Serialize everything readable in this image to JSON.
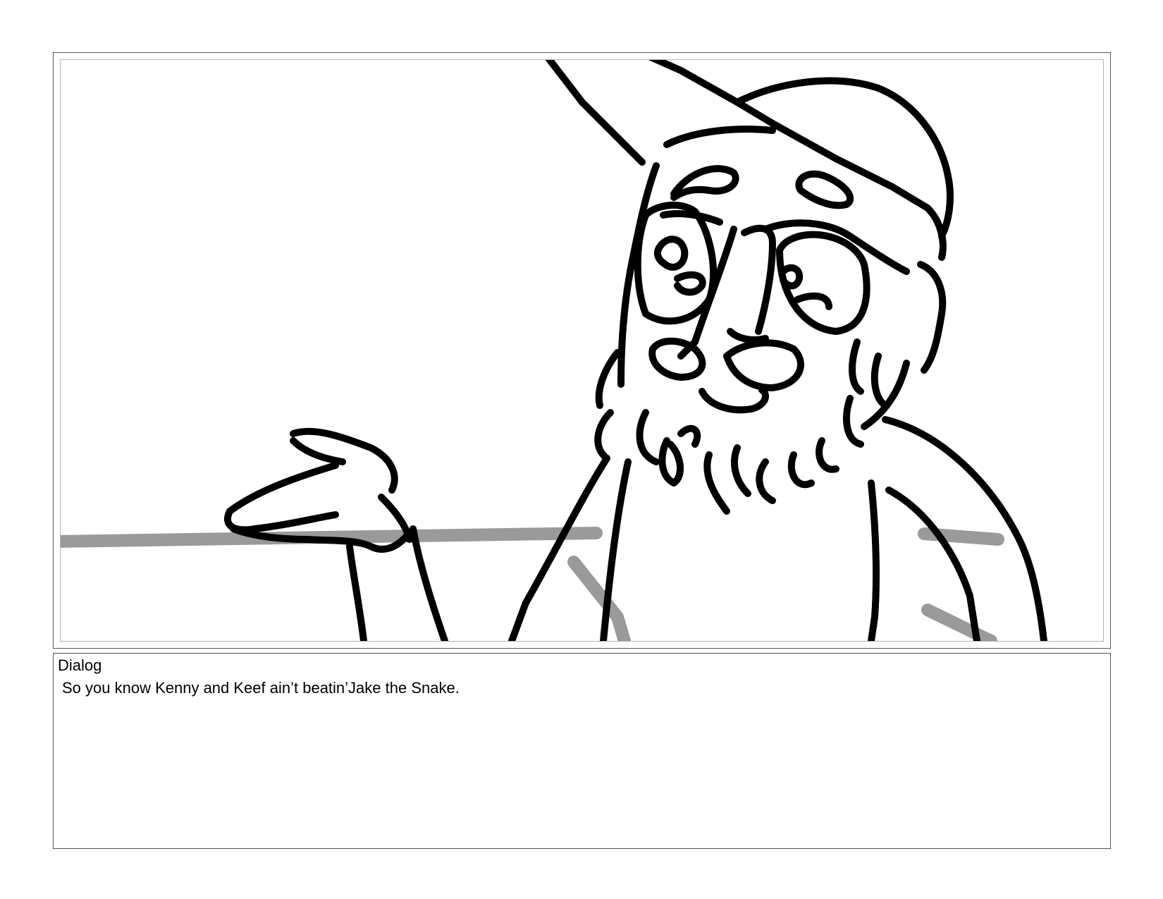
{
  "panel": {
    "description_icon": "storyboard-sketch-bearded-man"
  },
  "dialog": {
    "label": "Dialog",
    "text": "So you know Kenny and Keef ain’t beatin’Jake the Snake."
  }
}
